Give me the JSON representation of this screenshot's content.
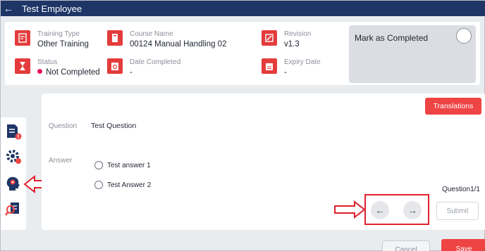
{
  "header": {
    "title": "Test Employee",
    "back_icon": "arrow-left-icon"
  },
  "info": {
    "training_type": {
      "label": "Training Type",
      "value": "Other Training"
    },
    "course_name": {
      "label": "Course Name",
      "value": "00124 Manual Handling 02"
    },
    "revision": {
      "label": "Revision",
      "value": "v1.3"
    },
    "status": {
      "label": "Status",
      "value": "Not Completed",
      "dot_color": "#e8175d"
    },
    "date_completed": {
      "label": "Date Completed",
      "value": "-"
    },
    "expiry_date": {
      "label": "Expiry Date",
      "value": "-"
    },
    "mark_completed": {
      "label": "Mark as Completed",
      "checked": false
    }
  },
  "question": {
    "translations_label": "Translations",
    "question_label": "Question",
    "question_text": "Test Question",
    "answer_label": "Answer",
    "options": [
      "Test answer 1",
      "Test Answer 2"
    ],
    "counter": "Question1/1",
    "prev_icon": "arrow-left-icon",
    "next_icon": "arrow-right-icon",
    "submit_label": "Submit"
  },
  "footer": {
    "cancel_label": "Cancel",
    "save_label": "Save"
  },
  "colors": {
    "header": "#1e3566",
    "accent": "#ef4444",
    "callout": "#e0202e"
  }
}
